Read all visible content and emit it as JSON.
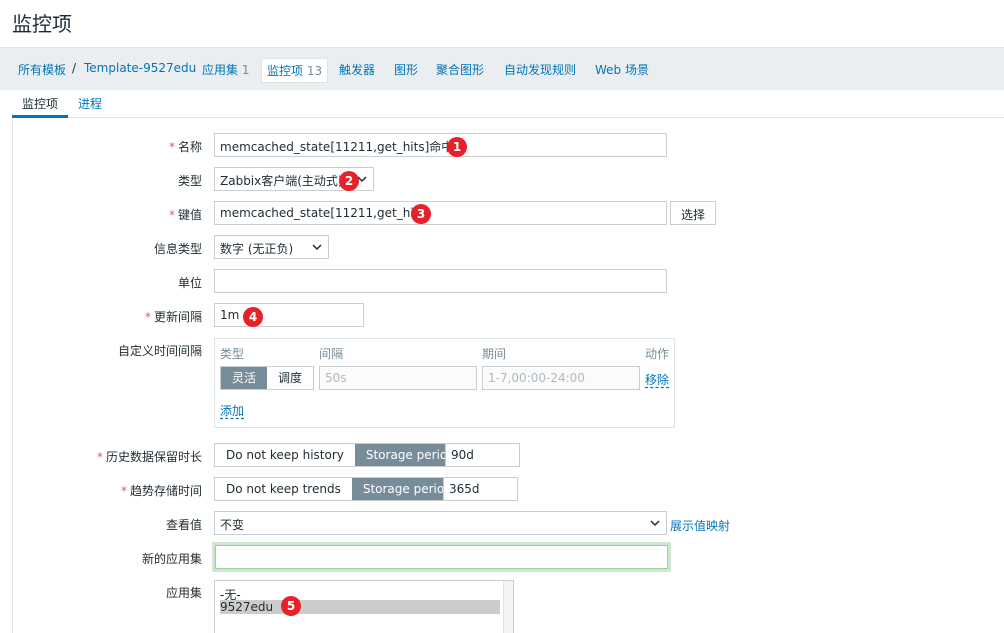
{
  "page": {
    "title": "监控项"
  },
  "breadcrumb": {
    "all_templates": "所有模板",
    "separator": "/",
    "template": "Template-9527edu",
    "items": [
      {
        "label": "应用集",
        "count": "1"
      },
      {
        "label": "监控项",
        "count": "13",
        "current": true
      },
      {
        "label": "触发器"
      },
      {
        "label": "图形"
      },
      {
        "label": "聚合图形"
      },
      {
        "label": "自动发现规则"
      },
      {
        "label": "Web 场景"
      }
    ]
  },
  "tabs": [
    {
      "label": "监控项",
      "active": true
    },
    {
      "label": "进程",
      "active": false
    }
  ],
  "form": {
    "required_mark": "*",
    "name": {
      "label": "名称",
      "value": "memcached_state[11211,get_hits]命中数"
    },
    "type": {
      "label": "类型",
      "value": "Zabbix客户端(主动式)"
    },
    "key": {
      "label": "键值",
      "value": "memcached_state[11211,get_hits]",
      "select_button": "选择"
    },
    "info_type": {
      "label": "信息类型",
      "value": "数字 (无正负)"
    },
    "units": {
      "label": "单位",
      "value": ""
    },
    "update_interval": {
      "label": "更新间隔",
      "value": "1m"
    },
    "custom_intervals": {
      "label": "自定义时间间隔",
      "headers": {
        "type": "类型",
        "interval": "间隔",
        "period": "期间",
        "action": "动作"
      },
      "row": {
        "flexible": "灵活",
        "scheduling": "调度",
        "interval_placeholder": "50s",
        "period_placeholder": "1-7,00:00-24:00",
        "remove": "移除"
      },
      "add": "添加"
    },
    "history": {
      "label": "历史数据保留时长",
      "option_off": "Do not keep history",
      "option_on": "Storage period",
      "value": "90d"
    },
    "trends": {
      "label": "趋势存储时间",
      "option_off": "Do not keep trends",
      "option_on": "Storage period",
      "value": "365d"
    },
    "show_value": {
      "label": "查看值",
      "value": "不变",
      "mapping_link": "展示值映射"
    },
    "new_application": {
      "label": "新的应用集",
      "value": ""
    },
    "applications": {
      "label": "应用集",
      "options": [
        "-无-",
        "9527edu"
      ],
      "selected": "9527edu"
    }
  },
  "annotations": [
    "1",
    "2",
    "3",
    "4",
    "5"
  ],
  "colors": {
    "accent": "#0275b8",
    "required": "#e45959",
    "segment_active": "#768d99",
    "badge": "#e8202a"
  }
}
